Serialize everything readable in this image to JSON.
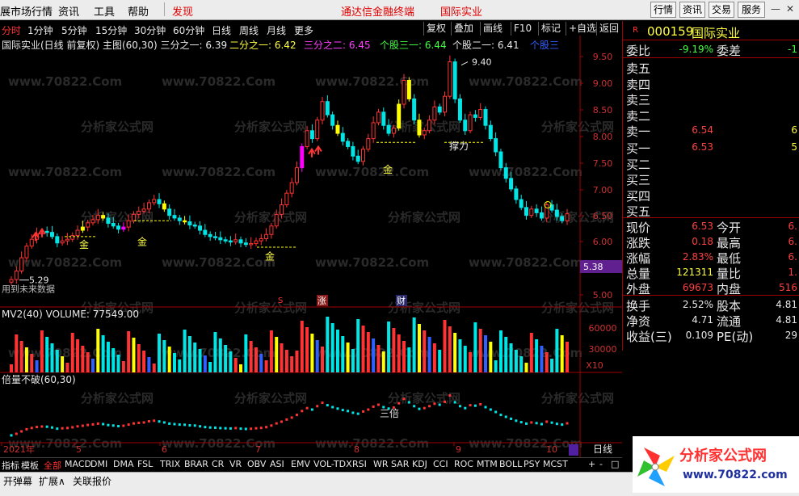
{
  "menubar": {
    "items": [
      "展市场行情",
      "资讯",
      "工具",
      "帮助",
      "发现"
    ],
    "center_title": "通达信金融终端",
    "center_stock": "国际实业",
    "right_buttons": [
      "行情",
      "资讯",
      "交易",
      "服务"
    ]
  },
  "periods": [
    "分时",
    "1分钟",
    "5分钟",
    "15分钟",
    "30分钟",
    "60分钟",
    "日线",
    "周线",
    "月线",
    "更多"
  ],
  "toolbar": [
    "复权",
    "叠加",
    "画线",
    "F10",
    "标记",
    "+自选",
    "返回"
  ],
  "legend": {
    "main": "国际实业(日线 前复权) 主图(60,30) 三分之一: 6.39",
    "l2": "二分之一: 6.42",
    "l3": "三分之二: 6.45",
    "l4": "个股三一: 6.44",
    "l5": "个股二一: 6.41",
    "l6": "个股三"
  },
  "annotations": {
    "high": "9.40",
    "low": "5.29",
    "future_note": "用到未来数据",
    "gold": "金",
    "pressure": "撑力",
    "three_times": "三倍",
    "cursor_price": "5.38",
    "event_s": "S",
    "event_zhang": "涨",
    "event_cai": "财"
  },
  "price_axis": [
    "9.50",
    "9.00",
    "8.50",
    "8.00",
    "7.50",
    "7.00",
    "6.50",
    "6.00",
    "5.50",
    "5.00"
  ],
  "volume_legend": "MV2(40) VOLUME: 77549.00",
  "volume_axis": [
    "60000",
    "30000",
    "X10"
  ],
  "indicator_legend": "倍量不破(60,30)",
  "date_axis": [
    "2021年",
    "5",
    "6",
    "7",
    "8",
    "9",
    "10"
  ],
  "date_axis_tab": "日线",
  "stock": {
    "code": "000159",
    "name": "国际实业",
    "marker": "R"
  },
  "quote": {
    "wei_bi_label": "委比",
    "wei_bi": "-9.19%",
    "wei_cha_label": "委差",
    "wei_cha": "-1",
    "sell": [
      {
        "label": "卖五",
        "price": "",
        "vol": ""
      },
      {
        "label": "卖四",
        "price": "",
        "vol": ""
      },
      {
        "label": "卖三",
        "price": "",
        "vol": ""
      },
      {
        "label": "卖二",
        "price": "",
        "vol": ""
      },
      {
        "label": "卖一",
        "price": "6.54",
        "vol": "6"
      }
    ],
    "buy": [
      {
        "label": "买一",
        "price": "6.53",
        "vol": "5"
      },
      {
        "label": "买二",
        "price": "",
        "vol": ""
      },
      {
        "label": "买三",
        "price": "",
        "vol": ""
      },
      {
        "label": "买四",
        "price": "",
        "vol": ""
      },
      {
        "label": "买五",
        "price": "",
        "vol": ""
      }
    ],
    "stats": [
      {
        "l1": "现价",
        "v1": "6.53",
        "c1": "#ff4040",
        "l2": "今开",
        "v2": "6."
      },
      {
        "l1": "涨跌",
        "v1": "0.18",
        "c1": "#ff4040",
        "l2": "最高",
        "v2": "6."
      },
      {
        "l1": "涨幅",
        "v1": "2.83%",
        "c1": "#ff4040",
        "l2": "最低",
        "v2": "6."
      },
      {
        "l1": "总量",
        "v1": "121311",
        "c1": "#ffff40",
        "l2": "量比",
        "v2": "1."
      },
      {
        "l1": "外盘",
        "v1": "69673",
        "c1": "#ff4040",
        "l2": "内盘",
        "v2": "516"
      }
    ],
    "stats2": [
      {
        "l1": "换手",
        "v1": "2.52%",
        "l2": "股本",
        "v2": "4.81"
      },
      {
        "l1": "净资",
        "v1": "4.71",
        "l2": "流通",
        "v2": "4.81"
      },
      {
        "l1": "收益(三)",
        "v1": "0.109",
        "l2": "PE(动)",
        "v2": "29"
      }
    ]
  },
  "bottom_tabs": [
    "指标",
    "模板",
    "全部",
    "MACD",
    "DMI",
    "DMA",
    "FSL",
    "TRIX",
    "BRAR",
    "CR",
    "VR",
    "OBV",
    "ASI",
    "EMV",
    "VOL-TDX",
    "RSI",
    "WR",
    "SAR",
    "KDJ",
    "CCI",
    "ROC",
    "MTM",
    "BOLL",
    "PSY",
    "MCST"
  ],
  "bottom_controls": [
    "+",
    "-",
    "□"
  ],
  "statusbar": [
    "开弹幕",
    "扩展∧",
    "关联报价"
  ],
  "watermark": "分析家公式网",
  "watermark_url": "www.70822.Com",
  "logo": {
    "title": "分析家公式网",
    "url": "www.70822.com"
  },
  "colors": {
    "up": "#ff3333",
    "down": "#00e5e5",
    "gold": "#ffff00",
    "magenta": "#ff00ff",
    "blue": "#3030ff"
  }
}
